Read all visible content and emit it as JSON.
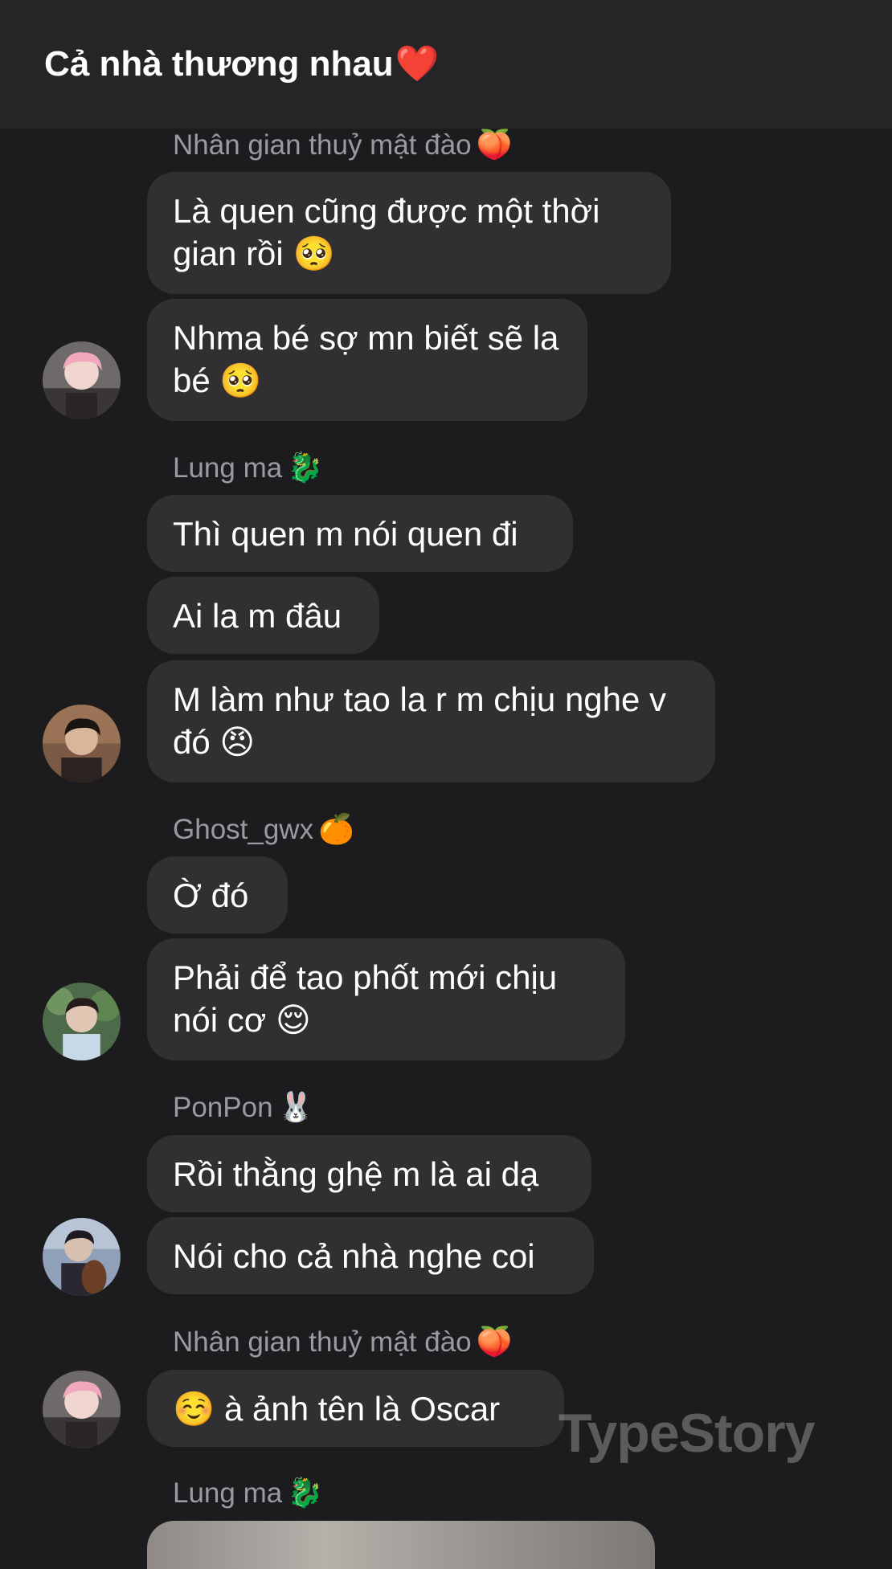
{
  "header": {
    "title": "Cả nhà thương nhau",
    "title_emoji": "❤️"
  },
  "groups": [
    {
      "sender": "Nhân gian thuỷ mật đào",
      "sender_emoji": "🍑",
      "avatar": "avatar-pink-hair",
      "messages": [
        {
          "text": "Là quen cũng được một thời gian rồi",
          "emoji": "🥺"
        },
        {
          "text": "Nhma bé sợ mn biết sẽ la bé",
          "emoji": "🥺"
        }
      ]
    },
    {
      "sender": "Lung ma",
      "sender_emoji": "🐉",
      "avatar": "avatar-dark-hair",
      "messages": [
        {
          "text": "Thì quen m nói quen đi",
          "emoji": ""
        },
        {
          "text": "Ai la m đâu",
          "emoji": ""
        },
        {
          "text": "M làm như tao la r m chịu nghe v đó",
          "emoji": "😠"
        }
      ]
    },
    {
      "sender": "Ghost_gwx",
      "sender_emoji": "🍊",
      "avatar": "avatar-outdoor",
      "messages": [
        {
          "text": "Ờ đó",
          "emoji": ""
        },
        {
          "text": "Phải để tao phốt mới chịu nói cơ",
          "emoji": "😌"
        }
      ]
    },
    {
      "sender": "PonPon",
      "sender_emoji": "🐰",
      "avatar": "avatar-guitar",
      "messages": [
        {
          "text": "Rồi thằng ghệ m là ai dạ",
          "emoji": ""
        },
        {
          "text": "Nói cho cả nhà nghe coi",
          "emoji": ""
        }
      ]
    },
    {
      "sender": "Nhân gian thuỷ mật đào",
      "sender_emoji": "🍑",
      "avatar": "avatar-pink-hair",
      "messages": [
        {
          "text": "à ảnh tên là Oscar",
          "emoji": "☺️",
          "emoji_first": true
        }
      ]
    },
    {
      "sender": "Lung ma",
      "sender_emoji": "🐉",
      "avatar": "",
      "messages": []
    }
  ],
  "watermark": "TypeStory"
}
